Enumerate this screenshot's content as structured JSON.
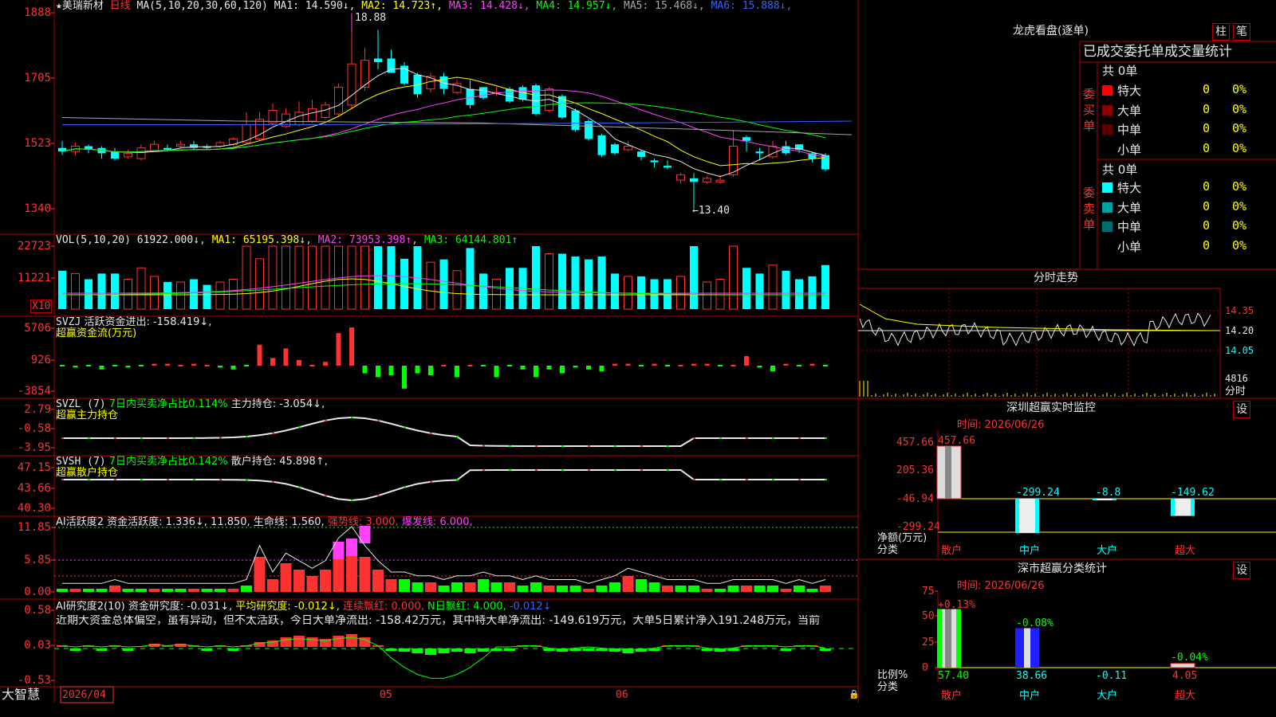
{
  "colors": {
    "up": "#ff3232",
    "down": "#00ffff",
    "grid": "#b00000",
    "axis": "#ff3232",
    "white": "#e8e8e8",
    "yellow": "#ffff00",
    "magenta": "#ff40ff",
    "green": "#00ff00",
    "blue": "#3264ff",
    "gray": "#a8a8a8"
  },
  "main": {
    "stock_name": "★美瑞新材",
    "period": "日线",
    "ma_label": "MA(5,10,20,30,60,120)",
    "ma_values": [
      {
        "label": "MA1: 14.590↓",
        "color": "#e8e8e8"
      },
      {
        "label": "MA2: 14.723↑",
        "color": "#ffff00"
      },
      {
        "label": "MA3: 14.428↓",
        "color": "#ff40ff"
      },
      {
        "label": "MA4: 14.957↓",
        "color": "#00ff00"
      },
      {
        "label": "MA5: 15.468↓",
        "color": "#a8a8a8"
      },
      {
        "label": "MA6: 15.888↓",
        "color": "#3264ff"
      }
    ],
    "y_ticks": [
      "1888",
      "1705",
      "1523",
      "1340"
    ],
    "high_label": "18.88",
    "low_label": "←13.40"
  },
  "vol": {
    "title": "VOL(5,10,20)",
    "value": "61922.000↓",
    "ma1": "MA1: 65195.398↓",
    "ma2": "MA2: 73953.398↑",
    "ma3": "MA3: 64144.801↑",
    "y_ticks": [
      "22723",
      "11221"
    ],
    "unit": "X10"
  },
  "svzj": {
    "title": "SVZJ",
    "line1": "活跃资金进出: -158.419↓,",
    "line2": "超赢资金流(万元)",
    "y_ticks": [
      "5706",
      "926",
      "-3854"
    ]
  },
  "svzl": {
    "title": "SVZL (7)",
    "stat": "7日内买卖净占比0.114%",
    "hold": "主力持仓: -3.054↓,",
    "line2": "超赢主力持仓",
    "y_ticks": [
      "2.79",
      "-0.58",
      "-3.95"
    ]
  },
  "svsh": {
    "title": "SVSH (7)",
    "stat": "7日内买卖净占比0.142%",
    "hold": "散户持仓: 45.898↑,",
    "line2": "超赢散户持仓",
    "y_ticks": [
      "47.15",
      "43.66",
      "40.30"
    ]
  },
  "ai1": {
    "title": "AI活跃度2",
    "a": "资金活跃度: 1.336↓,",
    "b": "11.850,",
    "c": "生命线: 1.560,",
    "d": "强势线: 3.000,",
    "e": "爆发线: 6.000,",
    "y_ticks": [
      "11.85",
      "5.85",
      "0.00"
    ]
  },
  "ai2": {
    "title": "AI研究度2(10)",
    "a": "资金研究度: -0.031↓,",
    "b": "平均研究度: -0.012↓,",
    "c": "连续飘红: 0.000,",
    "d": "N日飘红: 4.000,",
    "e": "-0.012↓",
    "comment": "近期大资金总体偏空，虽有异动，但不太活跃，今日大单净流出: -158.42万元，其中特大单净流出: -149.619万元，大单5日累计净入191.248万元，当前",
    "y_ticks": [
      "0.58",
      "0.03",
      "-0.53"
    ]
  },
  "bottom": {
    "app": "大智慧",
    "date": "2026/04",
    "m05": "05",
    "m06": "06"
  },
  "right": {
    "title": "龙虎看盘(逐单)",
    "btn_bar": "柱",
    "btn_pen": "笔",
    "tab_header": "已成交委托单成交量统计",
    "buy": {
      "side": "委买单",
      "total": "共 0单",
      "rows": [
        {
          "label": "特大",
          "val": "0",
          "pct": "0%",
          "color": "#ff0000"
        },
        {
          "label": "大单",
          "val": "0",
          "pct": "0%",
          "color": "#8b0000"
        },
        {
          "label": "中单",
          "val": "0",
          "pct": "0%",
          "color": "#5a0000"
        },
        {
          "label": "小单",
          "val": "0",
          "pct": "0%",
          "color": ""
        }
      ]
    },
    "sell": {
      "side": "委卖单",
      "total": "共 0单",
      "rows": [
        {
          "label": "特大",
          "val": "0",
          "pct": "0%",
          "color": "#00ffff"
        },
        {
          "label": "大单",
          "val": "0",
          "pct": "0%",
          "color": "#00a0a0"
        },
        {
          "label": "中单",
          "val": "0",
          "pct": "0%",
          "color": "#006e6e"
        },
        {
          "label": "小单",
          "val": "0",
          "pct": "0%",
          "color": ""
        }
      ]
    },
    "intraday": {
      "title": "分时走势",
      "p1": "14.35",
      "p2": "14.20",
      "p3": "14.05",
      "vol": "4816",
      "unit": "分时"
    },
    "monitor": {
      "title": "深圳超赢实时监控",
      "settings": "设",
      "time": "时间: 2026/06/26",
      "y_ticks": [
        "457.66",
        "205.36",
        "-46.94",
        "-299.24"
      ],
      "ylabel1": "净额(万元)",
      "ylabel2": "分类",
      "cats": [
        "散户",
        "中户",
        "大户",
        "超大"
      ],
      "values": [
        457.66,
        -299.24,
        -8.8,
        -149.62
      ],
      "value_labels": [
        "457.66",
        "-299.24",
        "-8.8",
        "-149.62"
      ]
    },
    "classify": {
      "title": "深市超赢分类统计",
      "settings": "设",
      "time": "时间: 2026/06/26",
      "y_ticks": [
        "75",
        "50",
        "25",
        "0"
      ],
      "ylabel1": "比例%",
      "ylabel2": "分类",
      "cats": [
        "散户",
        "中户",
        "大户",
        "超大"
      ],
      "values": [
        57.4,
        38.66,
        -0.11,
        4.05
      ],
      "value_labels": [
        "57.40",
        "38.66",
        "-0.11",
        "4.05"
      ],
      "changes": [
        "+0.13%",
        "-0.08%",
        "",
        "-0.04%"
      ]
    }
  },
  "chart_data": [
    {
      "type": "candlestick",
      "title": "美瑞新材 日线",
      "open": [
        15.1,
        15.0,
        15.15,
        15.1,
        15.0,
        14.85,
        14.8,
        15.0,
        15.1,
        15.15,
        15.2,
        15.15,
        15.15,
        15.2,
        15.25,
        15.35,
        15.8,
        15.7,
        15.75,
        15.85,
        15.95,
        16.05,
        16.3,
        16.8,
        17.6,
        17.6,
        17.4,
        17.15,
        16.75,
        17.1,
        16.65,
        16.75,
        16.8,
        16.65,
        16.75,
        16.8,
        16.85,
        16.15,
        16.55,
        16.15,
        15.85,
        15.45,
        15.2,
        15.05,
        15.0,
        14.75,
        14.6,
        14.2,
        14.25,
        14.15,
        14.15,
        14.35,
        15.4,
        15.0,
        14.85,
        15.15,
        15.2,
        14.95,
        14.9
      ],
      "close": [
        15.0,
        15.15,
        15.05,
        14.95,
        14.8,
        14.95,
        15.1,
        15.2,
        15.05,
        15.2,
        15.1,
        15.1,
        15.25,
        15.35,
        15.75,
        15.9,
        16.15,
        16.05,
        16.1,
        16.2,
        16.3,
        16.8,
        17.45,
        17.55,
        17.5,
        17.2,
        16.9,
        16.6,
        17.1,
        16.75,
        16.9,
        16.3,
        16.5,
        16.65,
        16.4,
        16.45,
        16.05,
        16.75,
        15.95,
        15.6,
        15.35,
        14.9,
        14.95,
        15.15,
        14.85,
        14.7,
        14.55,
        14.35,
        14.15,
        14.25,
        14.2,
        15.15,
        15.3,
        14.95,
        15.15,
        14.95,
        15.05,
        14.8,
        14.5
      ],
      "high": [
        15.3,
        15.25,
        15.2,
        15.15,
        15.1,
        15.05,
        15.2,
        15.3,
        15.2,
        15.3,
        15.3,
        15.2,
        15.3,
        15.4,
        16.1,
        16.1,
        16.35,
        16.2,
        16.4,
        16.45,
        16.4,
        16.9,
        18.88,
        17.9,
        18.4,
        17.85,
        17.5,
        17.2,
        17.2,
        17.2,
        17.0,
        17.0,
        16.8,
        16.8,
        16.8,
        16.85,
        16.9,
        16.8,
        16.6,
        16.2,
        15.9,
        15.5,
        15.25,
        15.3,
        15.05,
        14.8,
        14.75,
        14.4,
        14.4,
        14.3,
        14.35,
        15.6,
        15.45,
        15.1,
        15.3,
        15.3,
        15.2,
        15.0,
        14.95
      ],
      "low": [
        14.9,
        14.9,
        14.95,
        14.8,
        14.75,
        14.8,
        14.75,
        15.0,
        15.0,
        15.1,
        15.05,
        15.05,
        15.1,
        15.15,
        15.2,
        15.3,
        15.75,
        15.65,
        15.7,
        15.8,
        15.9,
        16.0,
        16.2,
        16.7,
        17.3,
        17.2,
        16.85,
        16.5,
        16.65,
        16.6,
        16.6,
        16.2,
        16.45,
        16.55,
        16.35,
        16.4,
        16.0,
        16.1,
        15.9,
        15.55,
        15.3,
        14.85,
        14.9,
        15.0,
        14.75,
        14.55,
        14.5,
        14.1,
        13.4,
        14.1,
        14.1,
        14.3,
        15.0,
        14.75,
        14.8,
        14.9,
        14.95,
        14.7,
        14.45
      ]
    },
    {
      "type": "bar",
      "title": "VOL(5,10,20)",
      "unit": "X10",
      "max": 22723
    }
  ]
}
